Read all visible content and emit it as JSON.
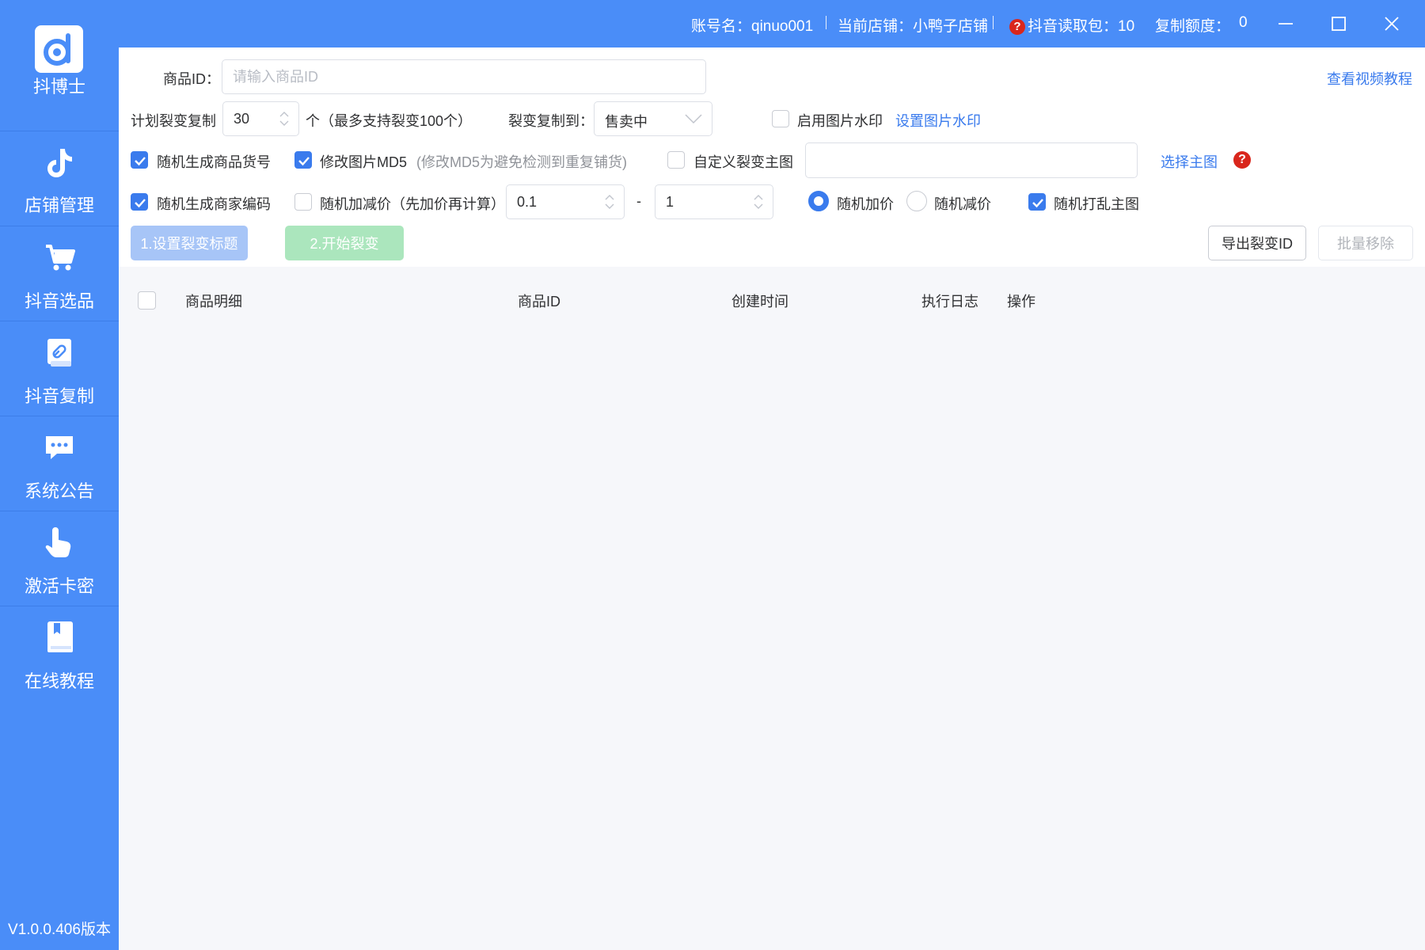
{
  "app": {
    "name": "抖博士",
    "version": "V1.0.0.406版本"
  },
  "sidebar": {
    "items": [
      {
        "label": "店铺管理",
        "icon": "tiktok-icon"
      },
      {
        "label": "抖音选品",
        "icon": "cart-icon"
      },
      {
        "label": "抖音复制",
        "icon": "link-icon"
      },
      {
        "label": "系统公告",
        "icon": "message-icon"
      },
      {
        "label": "激活卡密",
        "icon": "hand-pointer-icon"
      },
      {
        "label": "在线教程",
        "icon": "book-icon"
      }
    ]
  },
  "titlebar": {
    "account": "账号名：qinuo001",
    "store": "当前店铺：小鸭子店铺",
    "read_packs": "抖音读取包：10",
    "copy_quota_label": "复制额度：",
    "copy_quota_value": "0"
  },
  "form": {
    "product_id_label": "商品ID：",
    "product_id_placeholder": "请输入商品ID",
    "video_tutorial_link": "查看视频教程",
    "plan_label": "计划裂变复制",
    "plan_value": "30",
    "plan_unit": "个（最多支持裂变100个）",
    "copy_to_label": "裂变复制到：",
    "copy_to_value": "售卖中",
    "watermark_label": "启用图片水印",
    "watermark_link": "设置图片水印",
    "random_goods_no": "随机生成商品货号",
    "modify_md5": "修改图片MD5",
    "modify_md5_hint": "(修改MD5为避免检测到重复铺货)",
    "custom_main_image": "自定义裂变主图",
    "choose_main_image_link": "选择主图",
    "random_merchant_code": "随机生成商家编码",
    "random_price_adjust": "随机加减价（先加价再计算）",
    "price_min": "0.1",
    "price_dash": "-",
    "price_max": "1",
    "random_increase": "随机加价",
    "random_decrease": "随机减价",
    "shuffle_main_image": "随机打乱主图"
  },
  "buttons": {
    "set_titles": "1.设置裂变标题",
    "start": "2.开始裂变",
    "export_ids": "导出裂变ID",
    "batch_remove": "批量移除"
  },
  "table": {
    "columns": [
      "商品明细",
      "商品ID",
      "创建时间",
      "执行日志",
      "操作"
    ]
  },
  "colors": {
    "primary": "#4a8df8",
    "accent": "#3a7bed",
    "help_red": "#d9261c"
  }
}
